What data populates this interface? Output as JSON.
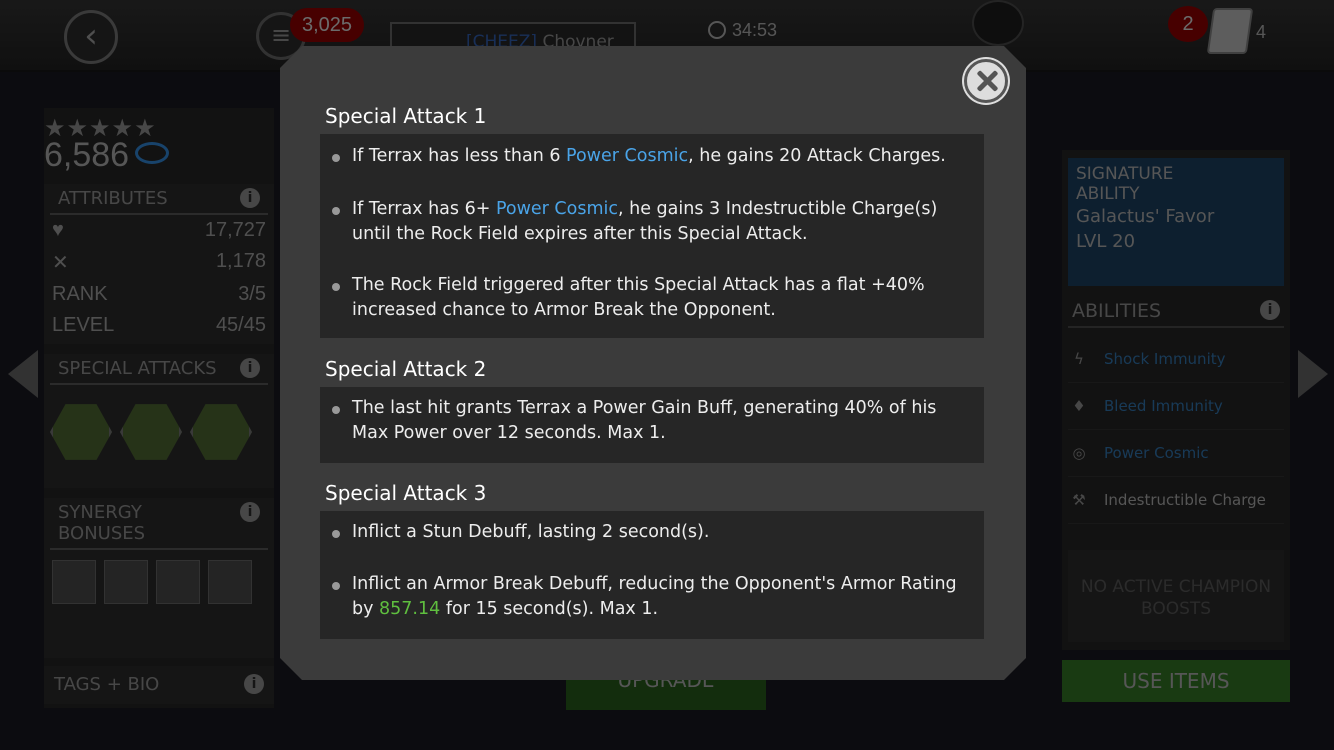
{
  "header": {
    "gold_count": "3,025",
    "alliance_tag": "[CHEEZ]",
    "player_name": "Chovner",
    "timer": "34:53",
    "notifications": "2",
    "crystal_count": "4"
  },
  "champion": {
    "stars": "★★★★★",
    "rating": "6,586",
    "attributes_label": "ATTRIBUTES",
    "health": "17,727",
    "attack": "1,178",
    "rank_label": "RANK",
    "rank": "3/5",
    "level_label": "LEVEL",
    "level": "45/45",
    "special_attacks_label": "SPECIAL ATTACKS",
    "synergy_label_1": "SYNERGY",
    "synergy_label_2": "BONUSES",
    "tags_label": "TAGS + BIO"
  },
  "signature": {
    "title_1": "SIGNATURE",
    "title_2": "ABILITY",
    "name": "Galactus' Favor",
    "level": "LVL 20"
  },
  "abilities": {
    "label": "ABILITIES",
    "items": [
      {
        "label": "Shock Immunity",
        "icon": "lightning-icon"
      },
      {
        "label": "Bleed Immunity",
        "icon": "blood-drop-icon"
      },
      {
        "label": "Power Cosmic",
        "icon": "cosmic-ring-icon"
      },
      {
        "label": "Indestructible Charge",
        "icon": "hammer-icon"
      }
    ],
    "boosts_1": "NO ACTIVE CHAMPION",
    "boosts_2": "BOOSTS",
    "use_items": "USE ITEMS",
    "upgrade": "UPGRADE"
  },
  "modal": {
    "sa1": {
      "title": "Special Attack 1",
      "b1_pre": "If Terrax has less than 6 ",
      "b1_hl": "Power Cosmic",
      "b1_post": ", he gains 20 Attack Charges.",
      "b2_pre": "If Terrax has 6+ ",
      "b2_hl": "Power Cosmic",
      "b2_post": ", he gains 3 Indestructible Charge(s) until the Rock Field expires after this Special Attack.",
      "b3": "The Rock Field triggered after this Special Attack has a flat +40% increased chance to Armor Break the Opponent."
    },
    "sa2": {
      "title": "Special Attack 2",
      "b1": "The last hit grants Terrax a Power Gain Buff, generating 40% of his Max Power over 12 seconds. Max 1."
    },
    "sa3": {
      "title": "Special Attack 3",
      "b1": "Inflict a Stun Debuff, lasting 2 second(s).",
      "b2_pre": "Inflict an Armor Break Debuff, reducing the Opponent's Armor Rating by ",
      "b2_hl": "857.14",
      "b2_post": " for 15 second(s). Max 1."
    }
  },
  "colors": {
    "keyword_blue": "#4aa4e8",
    "value_green": "#5fbf3f",
    "modal_bg": "#3b3b3b",
    "box_bg": "#262626"
  }
}
